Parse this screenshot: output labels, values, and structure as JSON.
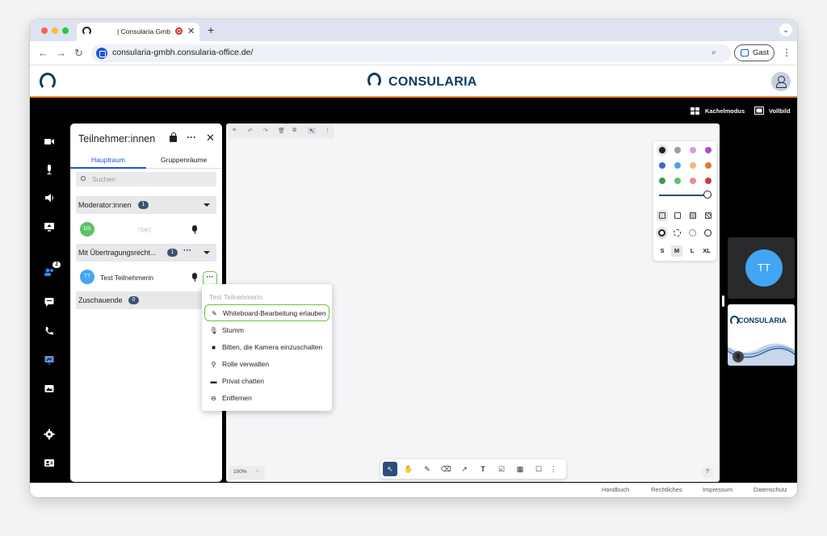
{
  "browser": {
    "tab_title": "| Consularia Gmbh",
    "url": "consularia-gmbh.consularia-office.de/",
    "guest_label": "Gast",
    "traffic_colors": [
      "#ff5f57",
      "#febc2e",
      "#28c840"
    ]
  },
  "site": {
    "brand": "CONSULARIA",
    "brand_color": "#0d3b66",
    "accent_line": "#f28c28"
  },
  "toolbar_top": {
    "tile_mode": "Kachelmodus",
    "fullscreen": "Vollbild"
  },
  "sidebar": {
    "icons": [
      "camera-icon",
      "microphone-icon",
      "speaker-icon",
      "screen-share-icon",
      "participants-icon",
      "chat-icon",
      "phone-icon",
      "whiteboard-icon",
      "files-icon",
      "settings-icon",
      "user-settings-icon"
    ],
    "participants_badge": "2"
  },
  "participants": {
    "title": "Teilnehmer:innen",
    "tabs": [
      "Hauptraum",
      "Gruppenräume"
    ],
    "search_placeholder": "Suchen",
    "moderators": {
      "label": "Moderator:innen",
      "count": "1"
    },
    "self": {
      "initials": "DS",
      "tag": "(Sie)"
    },
    "broadcasters": {
      "label": "Mit Übertragungsrecht...",
      "count": "1"
    },
    "test_user": {
      "initials": "TT",
      "name": "Test Teilnehmerin"
    },
    "viewers": {
      "label": "Zuschauende",
      "count": "0"
    }
  },
  "context_menu": {
    "header": "Test Teilnehmerin",
    "items": [
      {
        "label": "Whiteboard-Bearbeitung erlauben",
        "icon": "whiteboard-edit-icon",
        "highlighted": true
      },
      {
        "label": "Stumm",
        "icon": "mute-icon"
      },
      {
        "label": "Bitten, die Kamera einzuschalten",
        "icon": "camera-icon"
      },
      {
        "label": "Rolle verwalten",
        "icon": "role-icon"
      },
      {
        "label": "Privat chatten",
        "icon": "chat-icon"
      },
      {
        "label": "Entfernen",
        "icon": "remove-icon"
      }
    ]
  },
  "whiteboard": {
    "zoom": "100%",
    "sizes": [
      "S",
      "M",
      "L",
      "XL"
    ],
    "selected_size": "M",
    "help": "?",
    "colors": [
      "#222222",
      "#9e9e9e",
      "#d79be4",
      "#b04cc8",
      "#3f63d6",
      "#4aa3ee",
      "#f3b67c",
      "#e07a2e",
      "#3a9a4e",
      "#5cc16a",
      "#ea8f8f",
      "#d03a3a"
    ],
    "tools": [
      "select-icon",
      "hand-icon",
      "pen-icon",
      "eraser-icon",
      "arrow-icon",
      "text-icon",
      "note-icon",
      "image-icon",
      "rectangle-icon",
      "more-icon"
    ]
  },
  "tiles": {
    "remote_initials": "TT",
    "tile_brand": "CONSULARIA"
  },
  "footer": {
    "links": [
      "Handbuch",
      "Rechtliches",
      "Impressum",
      "Datenschutz"
    ]
  }
}
